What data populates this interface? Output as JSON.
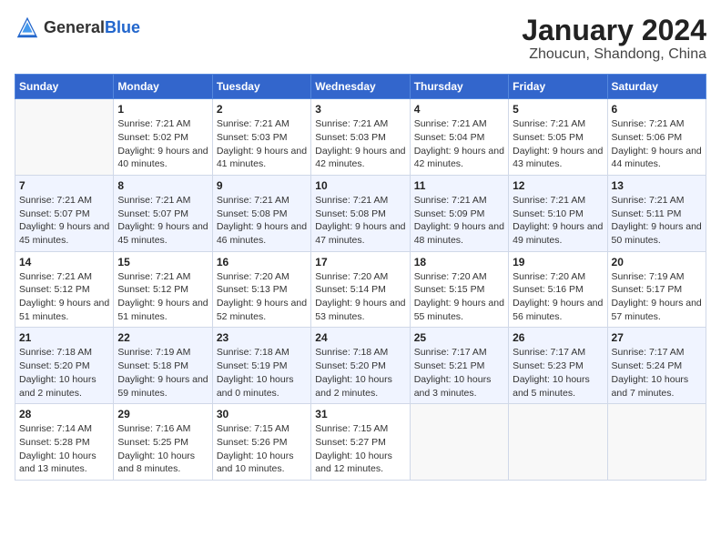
{
  "logo": {
    "general": "General",
    "blue": "Blue"
  },
  "title": "January 2024",
  "location": "Zhoucun, Shandong, China",
  "days_of_week": [
    "Sunday",
    "Monday",
    "Tuesday",
    "Wednesday",
    "Thursday",
    "Friday",
    "Saturday"
  ],
  "weeks": [
    [
      {
        "day": "",
        "info": ""
      },
      {
        "day": "1",
        "info": "Sunrise: 7:21 AM\nSunset: 5:02 PM\nDaylight: 9 hours\nand 40 minutes."
      },
      {
        "day": "2",
        "info": "Sunrise: 7:21 AM\nSunset: 5:03 PM\nDaylight: 9 hours\nand 41 minutes."
      },
      {
        "day": "3",
        "info": "Sunrise: 7:21 AM\nSunset: 5:03 PM\nDaylight: 9 hours\nand 42 minutes."
      },
      {
        "day": "4",
        "info": "Sunrise: 7:21 AM\nSunset: 5:04 PM\nDaylight: 9 hours\nand 42 minutes."
      },
      {
        "day": "5",
        "info": "Sunrise: 7:21 AM\nSunset: 5:05 PM\nDaylight: 9 hours\nand 43 minutes."
      },
      {
        "day": "6",
        "info": "Sunrise: 7:21 AM\nSunset: 5:06 PM\nDaylight: 9 hours\nand 44 minutes."
      }
    ],
    [
      {
        "day": "7",
        "info": ""
      },
      {
        "day": "8",
        "info": "Sunrise: 7:21 AM\nSunset: 5:07 PM\nDaylight: 9 hours\nand 45 minutes."
      },
      {
        "day": "9",
        "info": "Sunrise: 7:21 AM\nSunset: 5:08 PM\nDaylight: 9 hours\nand 46 minutes."
      },
      {
        "day": "10",
        "info": "Sunrise: 7:21 AM\nSunset: 5:08 PM\nDaylight: 9 hours\nand 47 minutes."
      },
      {
        "day": "11",
        "info": "Sunrise: 7:21 AM\nSunset: 5:09 PM\nDaylight: 9 hours\nand 48 minutes."
      },
      {
        "day": "12",
        "info": "Sunrise: 7:21 AM\nSunset: 5:10 PM\nDaylight: 9 hours\nand 49 minutes."
      },
      {
        "day": "13",
        "info": "Sunrise: 7:21 AM\nSunset: 5:11 PM\nDaylight: 9 hours\nand 50 minutes."
      }
    ],
    [
      {
        "day": "14",
        "info": ""
      },
      {
        "day": "15",
        "info": "Sunrise: 7:21 AM\nSunset: 5:12 PM\nDaylight: 9 hours\nand 51 minutes."
      },
      {
        "day": "16",
        "info": "Sunrise: 7:20 AM\nSunset: 5:13 PM\nDaylight: 9 hours\nand 52 minutes."
      },
      {
        "day": "17",
        "info": "Sunrise: 7:20 AM\nSunset: 5:14 PM\nDaylight: 9 hours\nand 53 minutes."
      },
      {
        "day": "18",
        "info": "Sunrise: 7:20 AM\nSunset: 5:15 PM\nDaylight: 9 hours\nand 55 minutes."
      },
      {
        "day": "19",
        "info": "Sunrise: 7:20 AM\nSunset: 5:16 PM\nDaylight: 9 hours\nand 56 minutes."
      },
      {
        "day": "20",
        "info": "Sunrise: 7:19 AM\nSunset: 5:17 PM\nDaylight: 9 hours\nand 57 minutes."
      }
    ],
    [
      {
        "day": "21",
        "info": ""
      },
      {
        "day": "22",
        "info": "Sunrise: 7:19 AM\nSunset: 5:18 PM\nDaylight: 9 hours\nand 59 minutes."
      },
      {
        "day": "23",
        "info": "Sunrise: 7:18 AM\nSunset: 5:19 PM\nDaylight: 10 hours\nand 0 minutes."
      },
      {
        "day": "24",
        "info": "Sunrise: 7:18 AM\nSunset: 5:20 PM\nDaylight: 10 hours\nand 2 minutes."
      },
      {
        "day": "25",
        "info": "Sunrise: 7:17 AM\nSunset: 5:21 PM\nDaylight: 10 hours\nand 3 minutes."
      },
      {
        "day": "26",
        "info": "Sunrise: 7:17 AM\nSunset: 5:23 PM\nDaylight: 10 hours\nand 5 minutes."
      },
      {
        "day": "27",
        "info": "Sunrise: 7:17 AM\nSunset: 5:24 PM\nDaylight: 10 hours\nand 7 minutes."
      }
    ],
    [
      {
        "day": "28",
        "info": ""
      },
      {
        "day": "29",
        "info": "Sunrise: 7:16 AM\nSunset: 5:25 PM\nDaylight: 10 hours\nand 8 minutes."
      },
      {
        "day": "30",
        "info": "Sunrise: 7:15 AM\nSunset: 5:26 PM\nDaylight: 10 hours\nand 10 minutes."
      },
      {
        "day": "31",
        "info": "Sunrise: 7:15 AM\nSunset: 5:27 PM\nDaylight: 10 hours\nand 12 minutes."
      },
      {
        "day": "",
        "info": ""
      },
      {
        "day": "",
        "info": ""
      },
      {
        "day": "",
        "info": ""
      }
    ]
  ],
  "week1_day7_info": "Sunrise: 7:21 AM\nSunset: 5:07 PM\nDaylight: 9 hours\nand 45 minutes.",
  "week2_day14_info": "Sunrise: 7:21 AM\nSunset: 5:12 PM\nDaylight: 9 hours\nand 51 minutes.",
  "week3_day21_info": "Sunrise: 7:18 AM\nSunset: 5:20 PM\nDaylight: 10 hours\nand 2 minutes.",
  "week4_day28_info": "Sunrise: 7:14 AM\nSunset: 5:28 PM\nDaylight: 10 hours\nand 13 minutes."
}
